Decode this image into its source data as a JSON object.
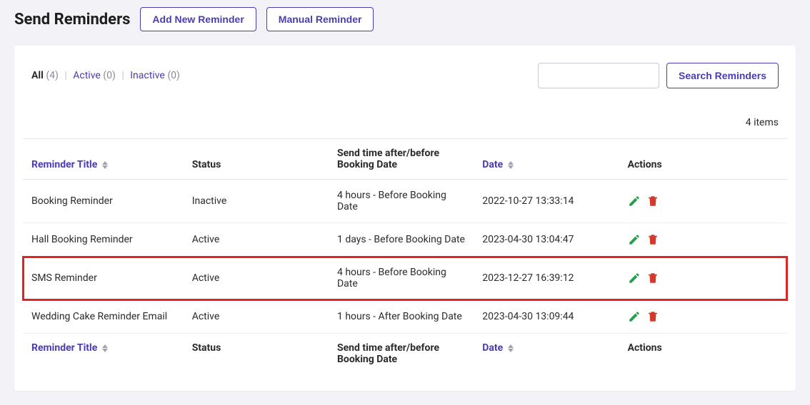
{
  "header": {
    "title": "Send Reminders",
    "add_new_label": "Add New Reminder",
    "manual_label": "Manual Reminder"
  },
  "filters": {
    "all_label": "All",
    "all_count": "(4)",
    "active_label": "Active",
    "active_count": "(0)",
    "inactive_label": "Inactive",
    "inactive_count": "(0)"
  },
  "search": {
    "button_label": "Search Reminders"
  },
  "items_count": "4 items",
  "columns": {
    "title": "Reminder Title",
    "status": "Status",
    "sendtime": "Send time after/before Booking Date",
    "date": "Date",
    "actions": "Actions"
  },
  "rows": [
    {
      "title": "Booking Reminder",
      "status": "Inactive",
      "sendtime": "4 hours - Before Booking Date",
      "date": "2022-10-27 13:33:14",
      "highlighted": false
    },
    {
      "title": "Hall Booking Reminder",
      "status": "Active",
      "sendtime": "1 days - Before Booking Date",
      "date": "2023-04-30 13:04:47",
      "highlighted": false
    },
    {
      "title": "SMS Reminder",
      "status": "Active",
      "sendtime": "4 hours - Before Booking Date",
      "date": "2023-12-27 16:39:12",
      "highlighted": true
    },
    {
      "title": "Wedding Cake Reminder Email",
      "status": "Active",
      "sendtime": "1 hours - After Booking Date",
      "date": "2023-04-30 13:09:44",
      "highlighted": false
    }
  ]
}
